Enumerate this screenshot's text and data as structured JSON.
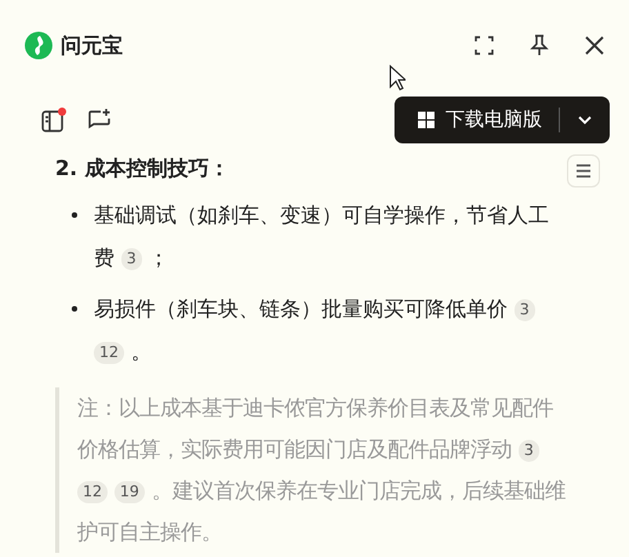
{
  "window": {
    "title": "问元宝"
  },
  "toolbar": {
    "sidebar_notification": true,
    "download_button": "下载电脑版"
  },
  "content": {
    "heading": "2. 成本控制技巧：",
    "bullets": [
      {
        "text": "基础调试（如刹车、变速）可自学操作，节省人工费",
        "citations": [
          "3"
        ],
        "tail": "；"
      },
      {
        "text": "易损件（刹车块、链条）批量购买可降低单价",
        "citations": [
          "3",
          "12"
        ],
        "tail": "。"
      }
    ],
    "note": {
      "text": "注：以上成本基于迪卡侬官方保养价目表及常见配件价格估算，实际费用可能因门店及配件品牌浮动",
      "citations": [
        "3",
        "12",
        "19"
      ],
      "tail": "。建议首次保养在专业门店完成，后续基础维护可自主操作。"
    }
  }
}
